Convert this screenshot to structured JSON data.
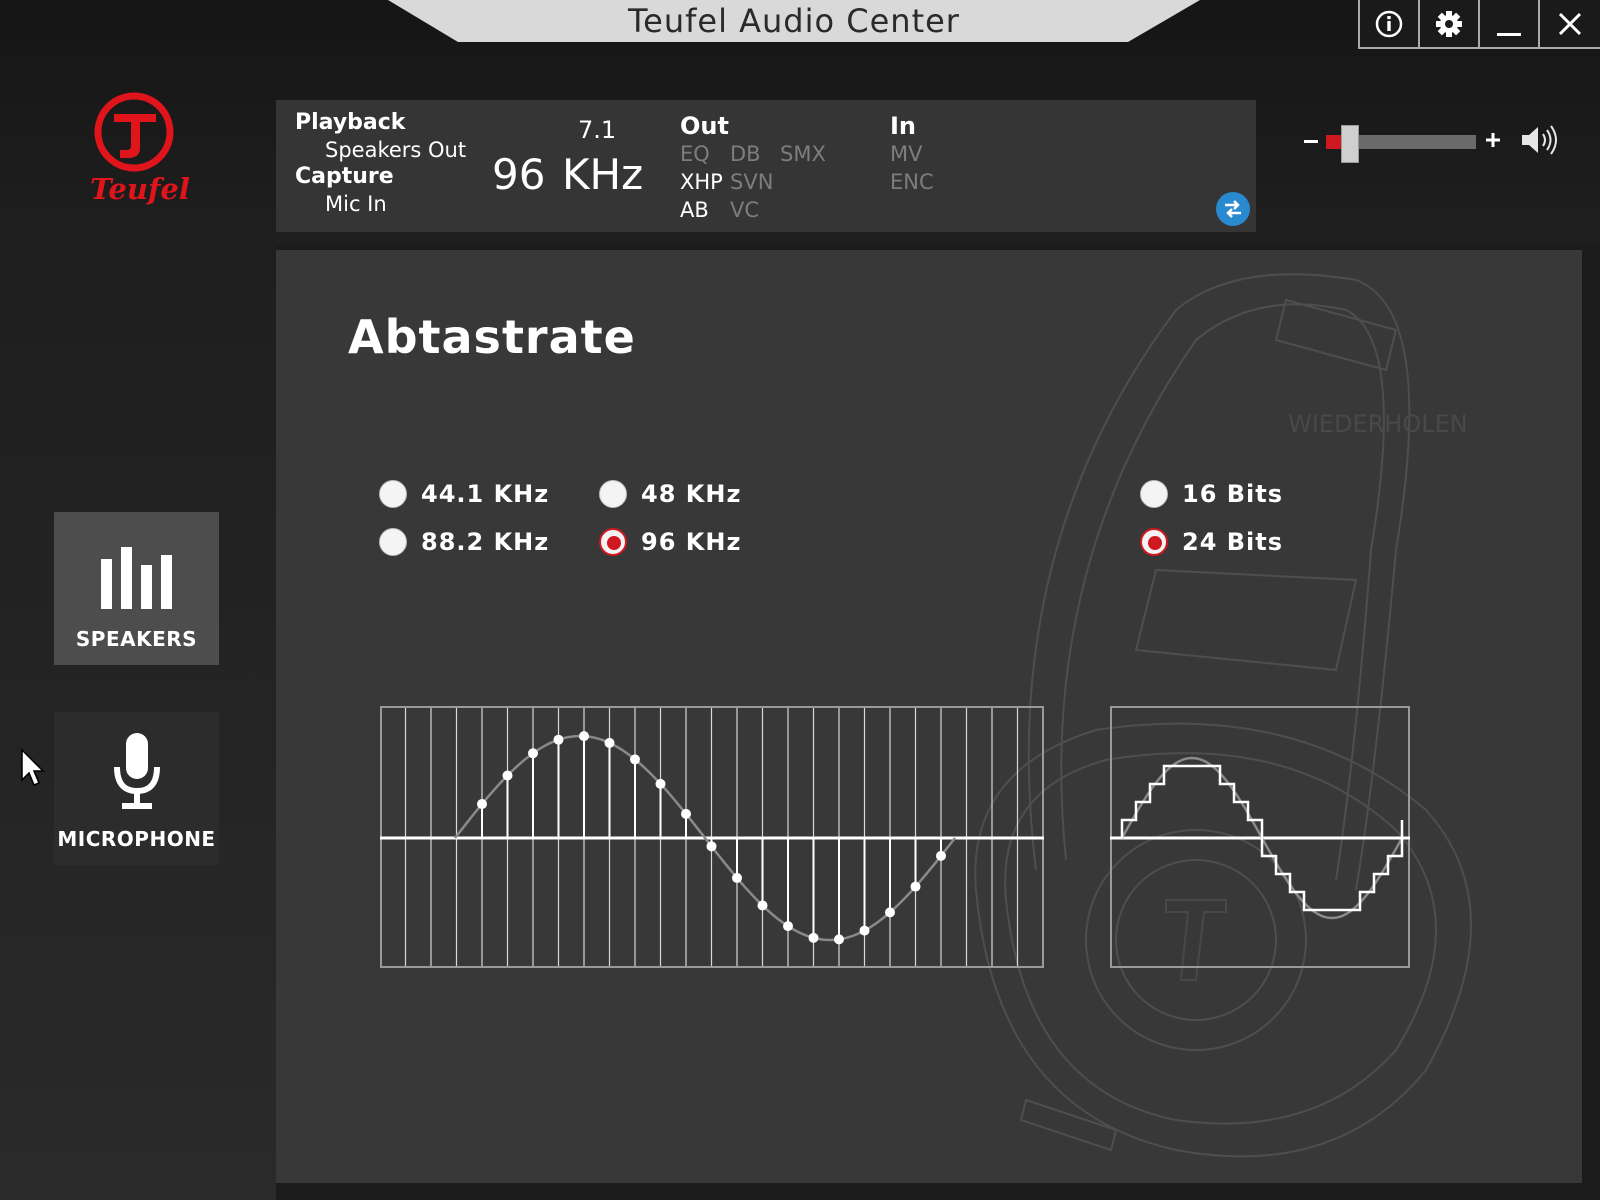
{
  "window": {
    "title": "Teufel Audio Center",
    "buttons": [
      "info-icon",
      "gear-icon",
      "minimize-icon",
      "close-icon"
    ]
  },
  "logo": {
    "text": "Teufel",
    "color": "#e0141b"
  },
  "status": {
    "playback_label": "Playback",
    "playback_device": "Speakers Out",
    "capture_label": "Capture",
    "capture_device": "Mic In",
    "channels": "7.1",
    "rate_value": "96",
    "rate_unit": "KHz",
    "out_label": "Out",
    "out_features": [
      "EQ",
      "DB",
      "SMX",
      "XHP",
      "SVN",
      "AB",
      "VC"
    ],
    "out_active": [
      "XHP",
      "AB"
    ],
    "in_label": "In",
    "in_features": [
      "MV",
      "ENC"
    ],
    "swap_icon": "swap-arrows-icon",
    "accent": "#2a8ad0"
  },
  "volume": {
    "minus_label": "–",
    "plus_label": "+",
    "level": 0.15,
    "icon": "speaker-volume-icon",
    "fill_color": "#d01820"
  },
  "sidebar": {
    "items": [
      {
        "label": "SPEAKERS",
        "icon": "speakers-bars-icon",
        "active": true
      },
      {
        "label": "MICROPHONE",
        "icon": "microphone-icon",
        "active": false
      }
    ]
  },
  "main": {
    "heading": "Abtastrate",
    "sample_rates": [
      {
        "label": "44.1 KHz",
        "selected": false
      },
      {
        "label": "48 KHz",
        "selected": false
      },
      {
        "label": "88.2 KHz",
        "selected": false
      },
      {
        "label": "96 KHz",
        "selected": true
      }
    ],
    "bit_depths": [
      {
        "label": "16 Bits",
        "selected": false
      },
      {
        "label": "24 Bits",
        "selected": true
      }
    ],
    "background_text": [
      "WIEDERHOLEN"
    ],
    "selected_color": "#d01820"
  }
}
